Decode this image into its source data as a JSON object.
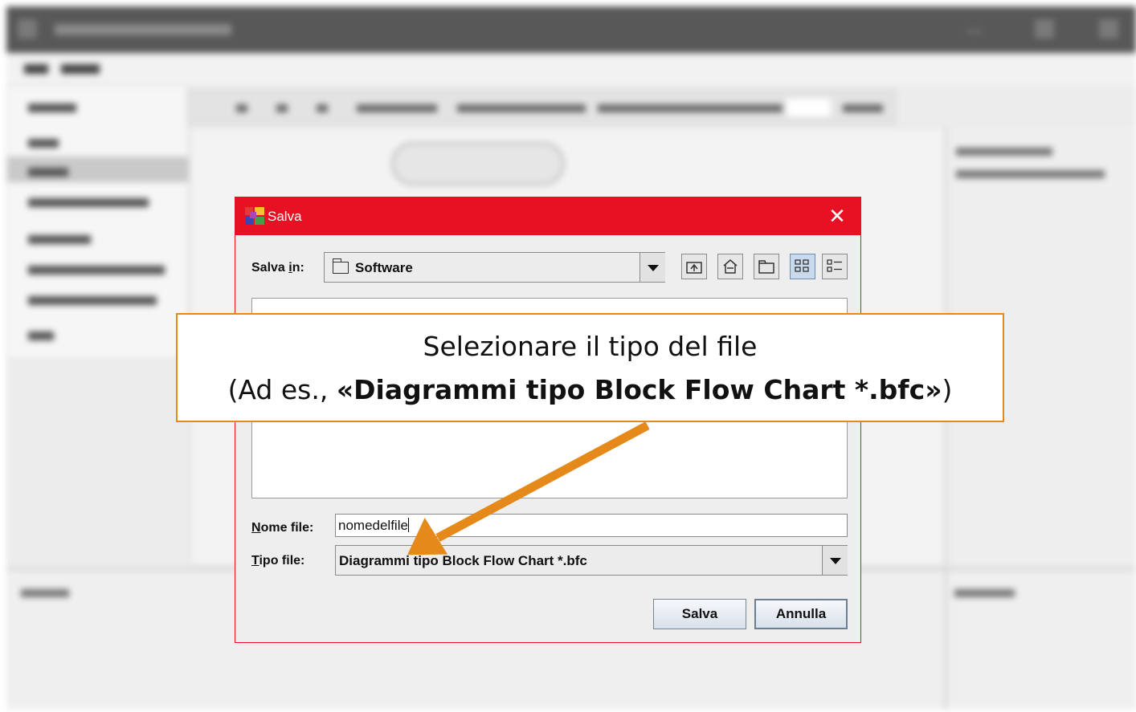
{
  "dialog": {
    "title": "Salva",
    "close_glyph": "✕",
    "look_in": {
      "label_pre": "Salva ",
      "label_mnemonic": "i",
      "label_post": "n:",
      "value": "Software",
      "icon": "folder-icon"
    },
    "toolbar_icons": [
      "up-one-level-icon",
      "home-icon",
      "new-folder-icon",
      "list-view-icon",
      "details-view-icon"
    ],
    "file_name": {
      "label_mnemonic": "N",
      "label_rest": "ome file:",
      "value": "nomedelfile"
    },
    "file_type": {
      "label_mnemonic": "T",
      "label_rest": "ipo file:",
      "value": "Diagrammi tipo Block Flow Chart *.bfc"
    },
    "buttons": {
      "save": "Salva",
      "cancel": "Annulla"
    }
  },
  "callout": {
    "line1": "Selezionare il tipo del file",
    "line2_pre": "(Ad es., ",
    "line2_bold": "«Diagrammi tipo Block Flow Chart *.bfc»",
    "line2_post": ")"
  },
  "colors": {
    "titlebar": "#e81123",
    "callout_border": "#e58a1a",
    "arrow": "#e58a1a"
  }
}
